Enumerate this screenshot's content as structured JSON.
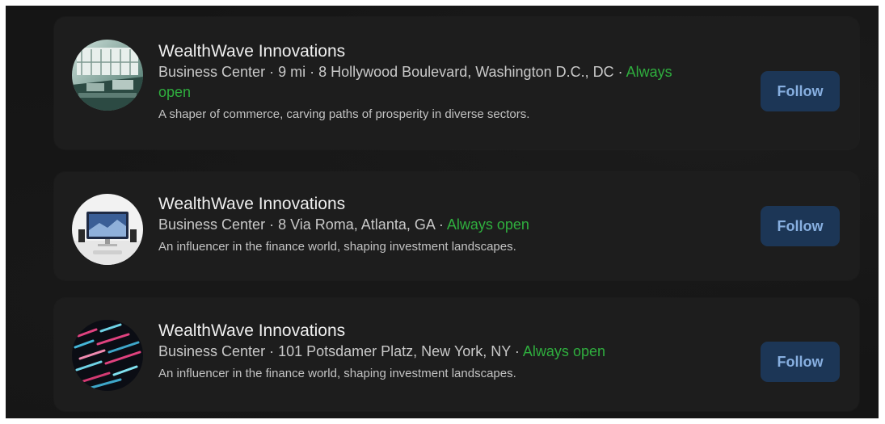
{
  "results": [
    {
      "name": "WealthWave Innovations",
      "category": "Business Center",
      "distance": "9 mi",
      "address": "8 Hollywood Boulevard, Washington D.C., DC",
      "hours": "Always open",
      "description": "A shaper of commerce, carving paths of prosperity in diverse sectors.",
      "follow_label": "Follow"
    },
    {
      "name": "WealthWave Innovations",
      "category": "Business Center",
      "address": "8 Via Roma, Atlanta, GA",
      "hours": "Always open",
      "description": "An influencer in the finance world, shaping investment landscapes.",
      "follow_label": "Follow"
    },
    {
      "name": "WealthWave Innovations",
      "category": "Business Center",
      "address": "101 Potsdamer Platz, New York, NY",
      "hours": "Always open",
      "description": "An influencer in the finance world, shaping investment landscapes.",
      "follow_label": "Follow"
    }
  ],
  "separator": " · ",
  "colors": {
    "background": "#151515",
    "card": "#1d1d1d",
    "open_status": "#2fae3e",
    "follow_button_bg": "#1c3656",
    "follow_button_text": "#87afe0"
  },
  "icons": {
    "avatar_1": "office-interior-photo",
    "avatar_2": "monitor-desk-photo",
    "avatar_3": "data-code-photo"
  }
}
